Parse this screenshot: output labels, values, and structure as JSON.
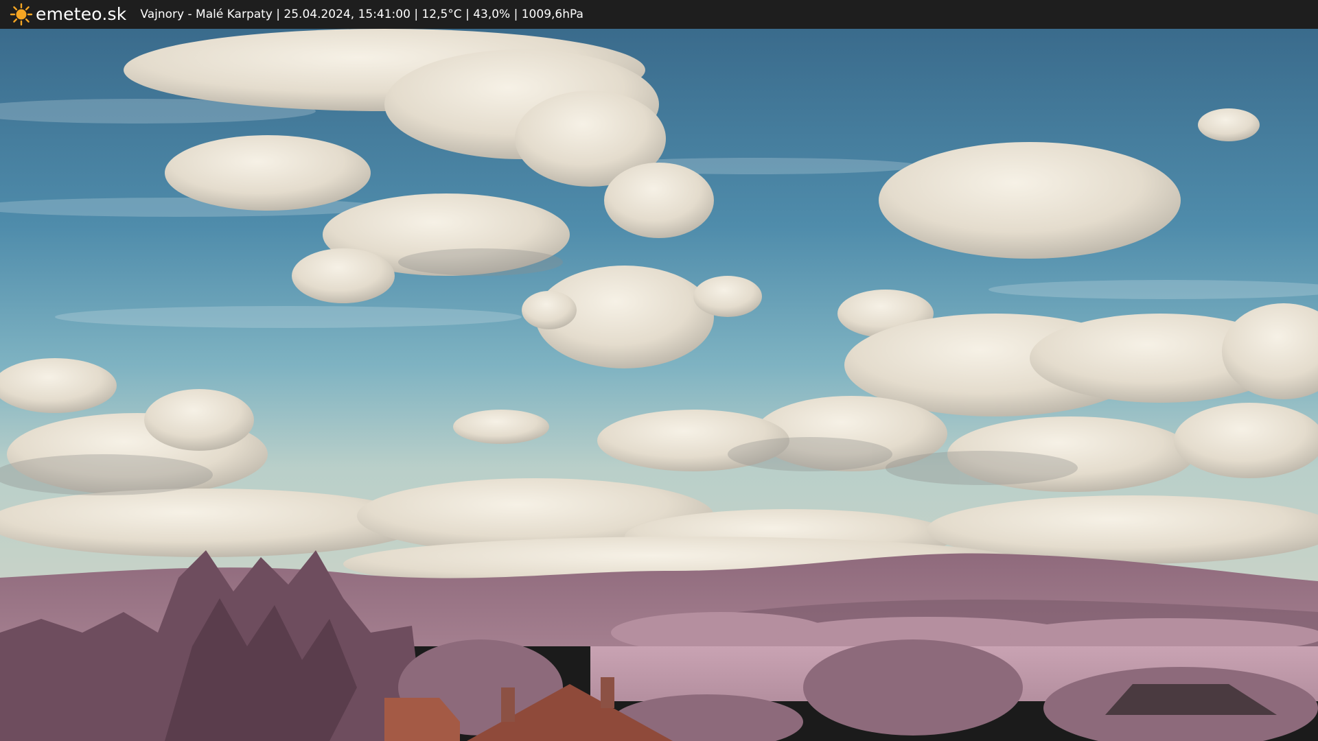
{
  "header": {
    "logo_icon": "sun-icon",
    "brand": "emeteo.sk",
    "caption": "Vajnory - Malé Karpaty | 25.04.2024, 15:41:00 | 12,5°C | 43,0% | 1009,6hPa"
  },
  "colors": {
    "header_bg": "#1e1e1e",
    "sun": "#f5a623",
    "sky_top": "#3d6f8f",
    "sky_mid": "#5f9bb4",
    "hills": "#8a6578",
    "trees": "#6a4a5a",
    "field": "#c7a3b3",
    "roof": "#9b4e3c"
  }
}
